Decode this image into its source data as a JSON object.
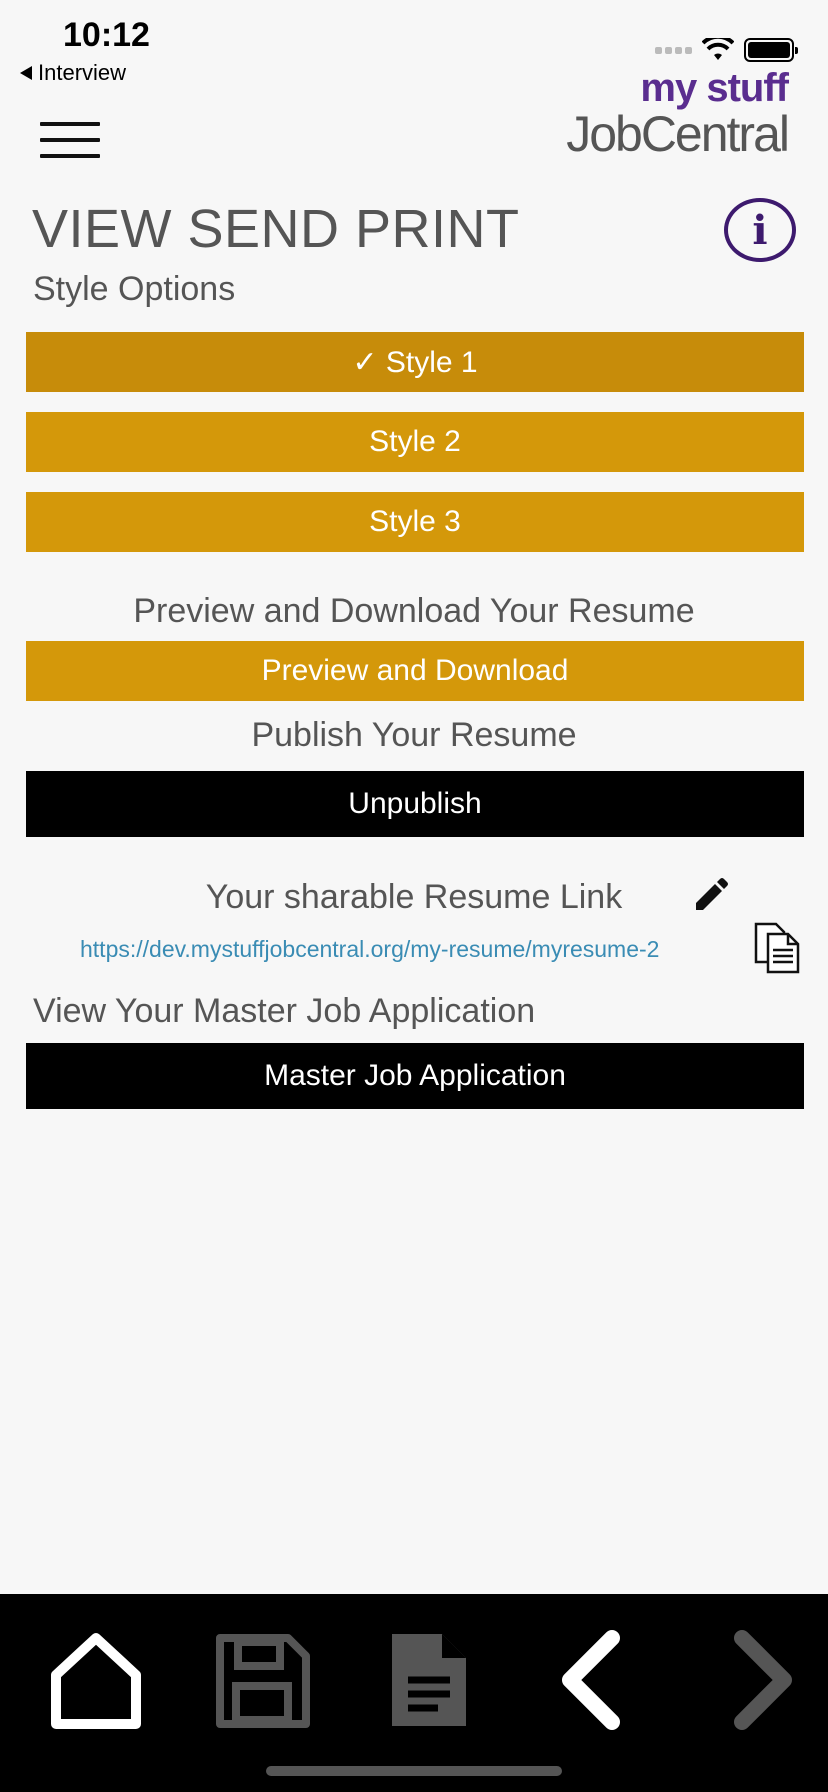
{
  "status_bar": {
    "time": "10:12",
    "back_app": "Interview"
  },
  "logo": {
    "top": "my stuff",
    "bottom": "JobCentral"
  },
  "page": {
    "title": "VIEW SEND PRINT",
    "style_options_label": "Style Options"
  },
  "styles": [
    {
      "label": "✓ Style 1",
      "selected": true
    },
    {
      "label": "Style 2",
      "selected": false
    },
    {
      "label": "Style 3",
      "selected": false
    }
  ],
  "preview": {
    "heading": "Preview and Download Your Resume",
    "button": "Preview and Download"
  },
  "publish": {
    "heading": "Publish Your Resume",
    "button": "Unpublish"
  },
  "share": {
    "heading": "Your sharable Resume Link",
    "link": "https://dev.mystuffjobcentral.org/my-resume/myresume-2"
  },
  "master": {
    "heading": "View Your Master Job Application",
    "button": "Master Job Application"
  },
  "bottom_nav": [
    {
      "icon": "home-icon"
    },
    {
      "icon": "save-icon"
    },
    {
      "icon": "document-icon"
    },
    {
      "icon": "chevron-left-icon"
    },
    {
      "icon": "chevron-right-icon"
    }
  ],
  "colors": {
    "accent_gold": "#d4980a",
    "brand_purple": "#5a2d8f",
    "link_blue": "#3a8cb4"
  }
}
